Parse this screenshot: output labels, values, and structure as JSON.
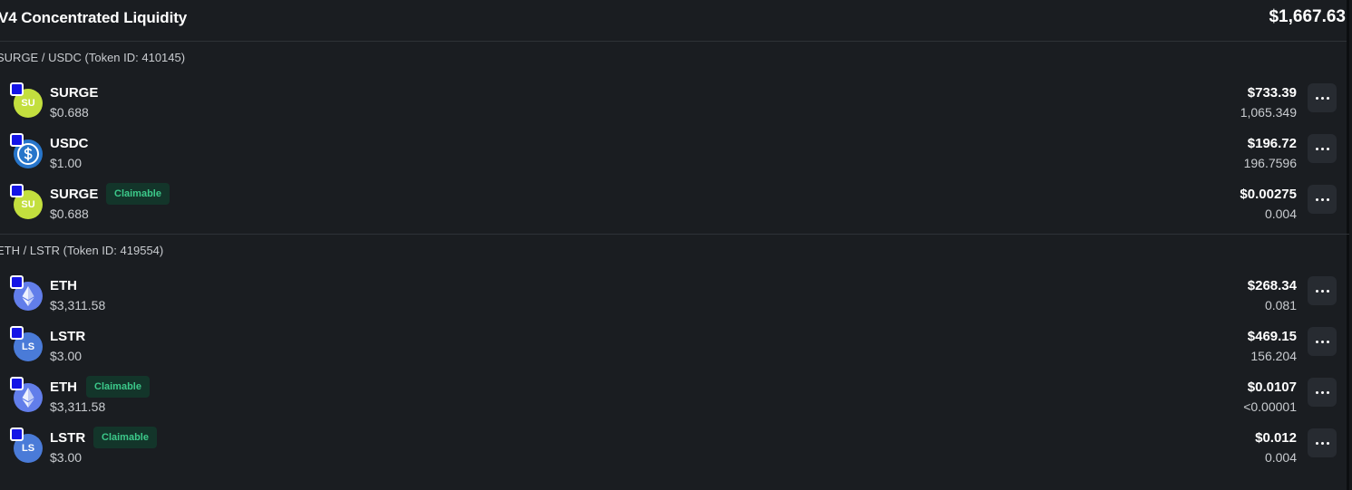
{
  "header": {
    "title": "V4 Concentrated Liquidity",
    "total": "$1,667.63"
  },
  "groups": [
    {
      "title": "SURGE / USDC (Token ID: 410145)",
      "rows": [
        {
          "icon": "surge-token-icon",
          "icon_text": "SU",
          "name": "SURGE",
          "price": "$0.688",
          "badge": "",
          "usd": "$733.39",
          "amount": "1,065.349"
        },
        {
          "icon": "usdc-token-icon",
          "icon_text": "",
          "name": "USDC",
          "price": "$1.00",
          "badge": "",
          "usd": "$196.72",
          "amount": "196.7596"
        },
        {
          "icon": "surge-token-icon",
          "icon_text": "SU",
          "name": "SURGE",
          "price": "$0.688",
          "badge": "Claimable",
          "usd": "$0.00275",
          "amount": "0.004"
        }
      ]
    },
    {
      "title": "ETH / LSTR (Token ID: 419554)",
      "rows": [
        {
          "icon": "eth-token-icon",
          "icon_text": "",
          "name": "ETH",
          "price": "$3,311.58",
          "badge": "",
          "usd": "$268.34",
          "amount": "0.081"
        },
        {
          "icon": "lstr-token-icon",
          "icon_text": "LS",
          "name": "LSTR",
          "price": "$3.00",
          "badge": "",
          "usd": "$469.15",
          "amount": "156.204"
        },
        {
          "icon": "eth-token-icon",
          "icon_text": "",
          "name": "ETH",
          "price": "$3,311.58",
          "badge": "Claimable",
          "usd": "$0.0107",
          "amount": "<0.00001"
        },
        {
          "icon": "lstr-token-icon",
          "icon_text": "LS",
          "name": "LSTR",
          "price": "$3.00",
          "badge": "Claimable",
          "usd": "$0.012",
          "amount": "0.004"
        }
      ]
    }
  ],
  "colors": {
    "background": "#1a1d21",
    "badge_bg": "#13352a",
    "badge_text": "#3cc98a",
    "surge": "#c3df3e",
    "usdc": "#2775ca",
    "eth": "#627eea",
    "lstr": "#4a7bd8"
  }
}
